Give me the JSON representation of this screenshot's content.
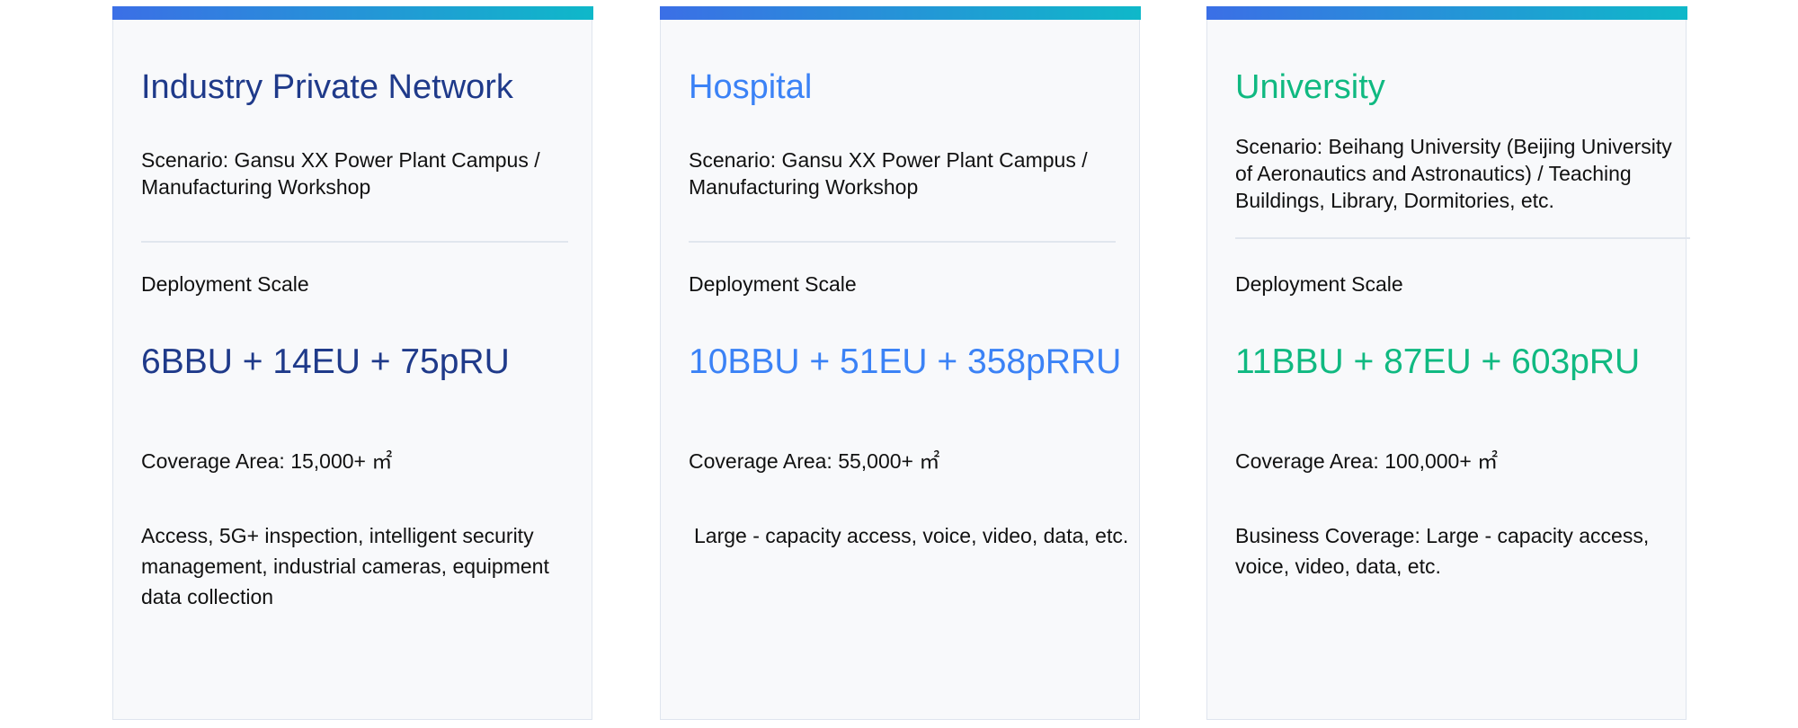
{
  "cards": [
    {
      "title": "Industry Private Network",
      "accent": "#1f3a8a",
      "scenario": "Scenario: Gansu XX Power Plant Campus / Manufacturing Workshop",
      "scale_label": "Deployment Scale",
      "scale_value": "6BBU + 14EU + 75pRU",
      "coverage": "Coverage Area: 15,000+ ㎡",
      "services": "Access, 5G+ inspection, intelligent security management, industrial cameras, equipment data collection"
    },
    {
      "title": "Hospital",
      "accent": "#3b82f6",
      "scenario": "Scenario: Gansu XX Power Plant Campus / Manufacturing Workshop",
      "scale_label": "Deployment Scale",
      "scale_value": "10BBU + 51EU + 358pRRU",
      "coverage": "Coverage Area: 55,000+ ㎡",
      "services": "Large - capacity access, voice, video, data, etc."
    },
    {
      "title": "University",
      "accent": "#10b981",
      "scenario": "Scenario: Beihang University (Beijing University of Aeronautics and Astronautics) / Teaching Buildings, Library, Dormitories, etc.",
      "scale_label": "Deployment Scale",
      "scale_value": "11BBU + 87EU + 603pRU",
      "coverage": "Coverage Area: 100,000+ ㎡",
      "services": "Business Coverage: Large - capacity access, voice, video, data, etc."
    }
  ]
}
